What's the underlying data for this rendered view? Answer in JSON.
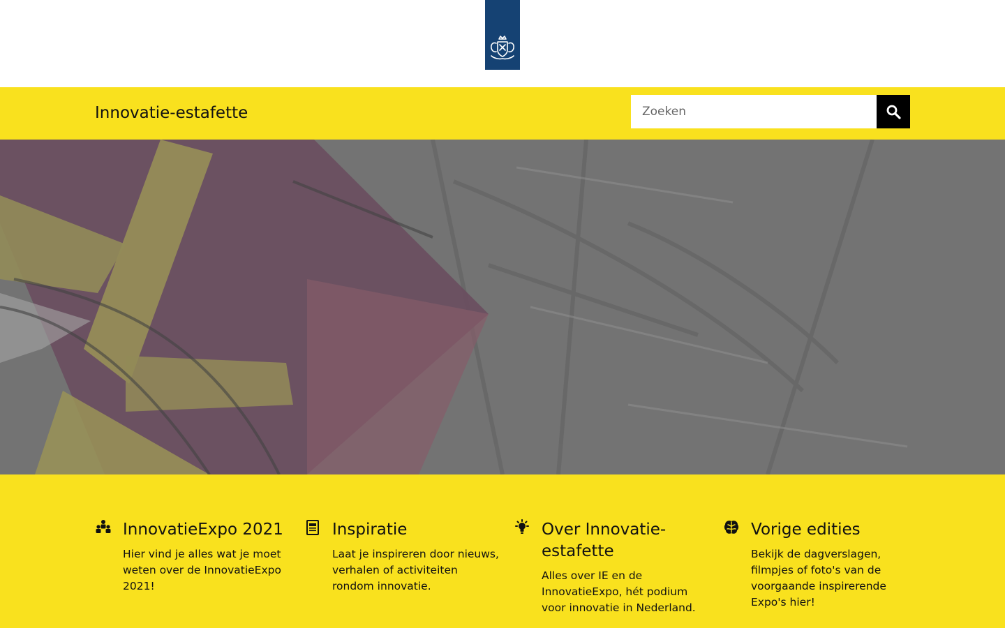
{
  "brand": {
    "logo_icon": "coat-of-arms-icon",
    "ribbon_color": "#154273"
  },
  "header": {
    "site_title": "Innovatie-estafette",
    "background_color": "#f9e11e"
  },
  "search": {
    "placeholder": "Zoeken",
    "value": "",
    "button_icon": "search-icon"
  },
  "hero": {
    "image": "hero-photo"
  },
  "features": [
    {
      "icon": "people-icon",
      "title": "InnovatieExpo 2021",
      "text": "Hier vind je alles wat je moet weten over de InnovatieExpo 2021!"
    },
    {
      "icon": "newspaper-icon",
      "title": "Inspiratie",
      "text": "Laat je inspireren door nieuws, verhalen of activiteiten rondom innovatie."
    },
    {
      "icon": "lightbulb-icon",
      "title": "Over Innovatie-estafette",
      "text": "Alles over IE en de InnovatieExpo, hét podium voor innovatie in Nederland."
    },
    {
      "icon": "brain-icon",
      "title": "Vorige edities",
      "text": "Bekijk de dagverslagen, filmpjes of foto's van de voorgaande inspirerende Expo's hier!"
    }
  ]
}
